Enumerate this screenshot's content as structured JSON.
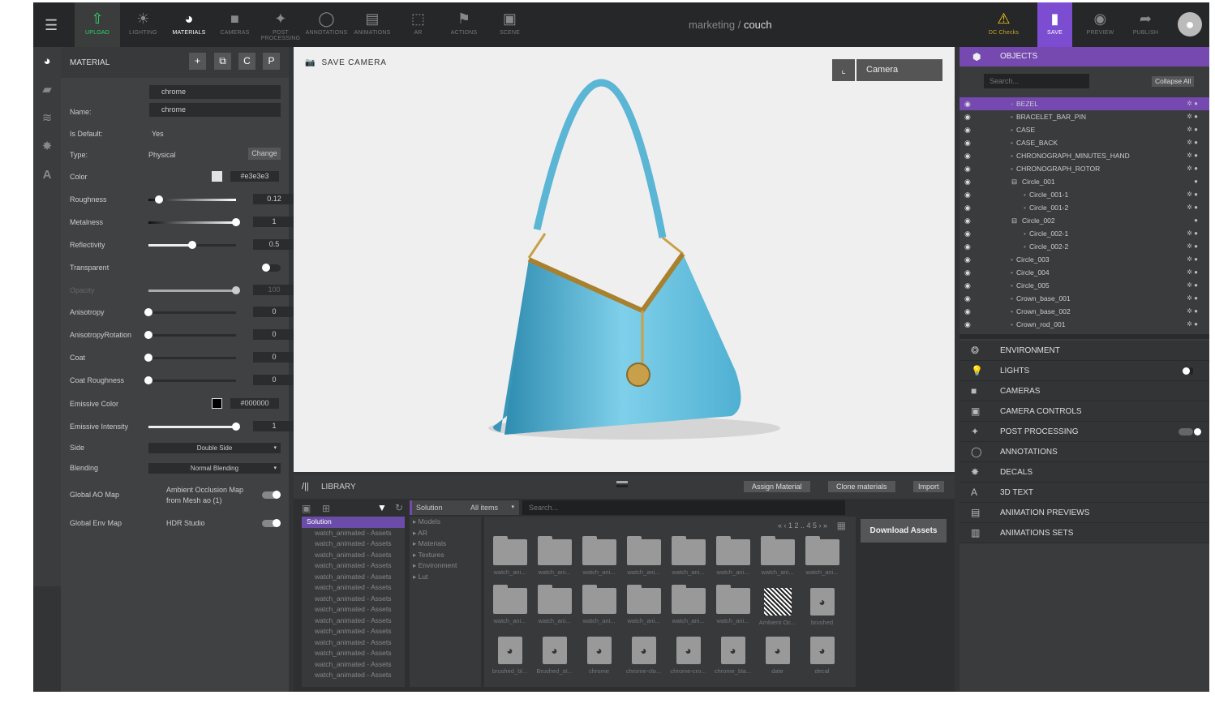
{
  "topbar": {
    "tools": [
      {
        "label": "UPLOAD",
        "icon": "upload-icon",
        "glyph": "⇧"
      },
      {
        "label": "LIGHTING",
        "icon": "sun-icon",
        "glyph": "☀"
      },
      {
        "label": "MATERIALS",
        "icon": "material-icon",
        "glyph": "◕"
      },
      {
        "label": "CAMERAS",
        "icon": "video-camera-icon",
        "glyph": "■"
      },
      {
        "label": "POST PROCESSING",
        "icon": "sparkles-icon",
        "glyph": "✦"
      },
      {
        "label": "ANNOTATIONS",
        "icon": "speech-bubble-icon",
        "glyph": "◯"
      },
      {
        "label": "ANIMATIONS",
        "icon": "film-icon",
        "glyph": "▤"
      },
      {
        "label": "AR",
        "icon": "ar-cube-icon",
        "glyph": "⬚"
      },
      {
        "label": "ACTIONS",
        "icon": "flag-icon",
        "glyph": "⚑"
      },
      {
        "label": "SCENE",
        "icon": "image-icon",
        "glyph": "▣"
      }
    ],
    "breadcrumb": {
      "project": "marketing",
      "separator": "/",
      "scene": "couch"
    },
    "right_tools": [
      {
        "label": "DC Checks",
        "icon": "warning-icon",
        "glyph": "⚠"
      },
      {
        "label": "SAVE",
        "icon": "bookmark-icon",
        "glyph": "▮"
      },
      {
        "label": "PREVIEW",
        "icon": "eye-icon",
        "glyph": "◉"
      },
      {
        "label": "PUBLISH",
        "icon": "share-arrow-icon",
        "glyph": "➦"
      }
    ]
  },
  "material": {
    "title": "MATERIAL",
    "search_value": "chrome",
    "name_label": "Name:",
    "name_value": "chrome",
    "is_default_label": "Is Default:",
    "is_default_value": "Yes",
    "type_label": "Type:",
    "type_value": "Physical",
    "change_label": "Change",
    "color": {
      "label": "Color",
      "value": "#e3e3e3"
    },
    "sliders": [
      {
        "label": "Roughness",
        "value": "0.12",
        "fraction": 0.12
      },
      {
        "label": "Metalness",
        "value": "1",
        "fraction": 1
      },
      {
        "label": "Reflectivity",
        "value": "0.5",
        "fraction": 0.5
      }
    ],
    "transparent_label": "Transparent",
    "transparent_on": false,
    "opacity": {
      "label": "Opacity",
      "value": "100",
      "fraction": 1
    },
    "sliders2": [
      {
        "label": "Anisotropy",
        "value": "0",
        "fraction": 0
      },
      {
        "label": "AnisotropyRotation",
        "value": "0",
        "fraction": 0
      },
      {
        "label": "Coat",
        "value": "0",
        "fraction": 0
      },
      {
        "label": "Coat Roughness",
        "value": "0",
        "fraction": 0
      }
    ],
    "emissive_color": {
      "label": "Emissive Color",
      "value": "#000000"
    },
    "emissive_intensity": {
      "label": "Emissive Intensity",
      "value": "1",
      "fraction": 1
    },
    "side": {
      "label": "Side",
      "value": "Double Side"
    },
    "blending": {
      "label": "Blending",
      "value": "Normal Blending"
    },
    "ao": {
      "label": "Global AO Map",
      "value": "Ambient Occlusion Map from Mesh ao (1)",
      "on": true
    },
    "env": {
      "label": "Global Env Map",
      "value": "HDR Studio",
      "on": true
    }
  },
  "viewport": {
    "save_camera": "SAVE CAMERA",
    "camera_select": "Camera"
  },
  "library": {
    "title": "LIBRARY",
    "buttons": [
      "Assign Material",
      "Clone materials",
      "Import"
    ],
    "filter_source": "Solution",
    "filter_items": "All items",
    "search_placeholder": "Search...",
    "download": "Download Assets",
    "tree_root": "Solution",
    "tree_items": [
      "watch_animated - Assets",
      "watch_animated - Assets",
      "watch_animated - Assets",
      "watch_animated - Assets",
      "watch_animated - Assets",
      "watch_animated - Assets",
      "watch_animated - Assets",
      "watch_animated - Assets",
      "watch_animated - Assets",
      "watch_animated - Assets",
      "watch_animated - Assets",
      "watch_animated - Assets",
      "watch_animated - Assets",
      "watch_animated - Assets"
    ],
    "categories": [
      "Models",
      "AR",
      "Materials",
      "Textures",
      "Environment",
      "Lut"
    ],
    "pagination": "« ‹ 1 2 .. 4 5 › »",
    "assets": [
      {
        "n": "watch_ani...",
        "k": "folder"
      },
      {
        "n": "watch_ani...",
        "k": "folder"
      },
      {
        "n": "watch_ani...",
        "k": "folder"
      },
      {
        "n": "watch_ani...",
        "k": "folder"
      },
      {
        "n": "watch_ani...",
        "k": "folder"
      },
      {
        "n": "watch_ani...",
        "k": "folder"
      },
      {
        "n": "watch_ani...",
        "k": "folder"
      },
      {
        "n": "watch_ani...",
        "k": "folder"
      },
      {
        "n": "watch_ani...",
        "k": "folder"
      },
      {
        "n": "watch_ani...",
        "k": "folder"
      },
      {
        "n": "watch_ani...",
        "k": "folder"
      },
      {
        "n": "watch_ani...",
        "k": "folder"
      },
      {
        "n": "watch_ani...",
        "k": "folder"
      },
      {
        "n": "watch_ani...",
        "k": "folder"
      },
      {
        "n": "Ambient Oc...",
        "k": "texture"
      },
      {
        "n": "brushed",
        "k": "material"
      },
      {
        "n": "brushed_bl...",
        "k": "material"
      },
      {
        "n": "Brushed_st...",
        "k": "material"
      },
      {
        "n": "chrome",
        "k": "material"
      },
      {
        "n": "chrome-clo...",
        "k": "material"
      },
      {
        "n": "chrome-cro...",
        "k": "material"
      },
      {
        "n": "chrome_bla...",
        "k": "material"
      },
      {
        "n": "date",
        "k": "material"
      },
      {
        "n": "decal",
        "k": "material"
      }
    ]
  },
  "objects": {
    "title": "OBJECTS",
    "search_placeholder": "Search...",
    "collapse_all": "Collapse All",
    "items": [
      {
        "n": "BEZEL",
        "d": 0,
        "sel": true
      },
      {
        "n": "BRACELET_BAR_PIN",
        "d": 0
      },
      {
        "n": "CASE",
        "d": 0
      },
      {
        "n": "CASE_BACK",
        "d": 0
      },
      {
        "n": "CHRONOGRAPH_MINUTES_HAND",
        "d": 0
      },
      {
        "n": "CHRONOGRAPH_ROTOR",
        "d": 0
      },
      {
        "n": "Circle_001",
        "d": 0,
        "group": true
      },
      {
        "n": "Circle_001-1",
        "d": 1
      },
      {
        "n": "Circle_001-2",
        "d": 1
      },
      {
        "n": "Circle_002",
        "d": 0,
        "group": true
      },
      {
        "n": "Circle_002-1",
        "d": 1
      },
      {
        "n": "Circle_002-2",
        "d": 1
      },
      {
        "n": "Circle_003",
        "d": 0
      },
      {
        "n": "Circle_004",
        "d": 0
      },
      {
        "n": "Circle_005",
        "d": 0
      },
      {
        "n": "Crown_base_001",
        "d": 0
      },
      {
        "n": "Crown_base_002",
        "d": 0
      },
      {
        "n": "Crown_rod_001",
        "d": 0
      }
    ]
  },
  "sections": [
    {
      "label": "ENVIRONMENT",
      "icon": "globe-icon",
      "glyph": "❂"
    },
    {
      "label": "LIGHTS",
      "icon": "lightbulb-icon",
      "glyph": "💡",
      "toggle": true
    },
    {
      "label": "CAMERAS",
      "icon": "video-camera-icon",
      "glyph": "■"
    },
    {
      "label": "CAMERA CONTROLS",
      "icon": "camera-controls-icon",
      "glyph": "▣"
    },
    {
      "label": "POST PROCESSING",
      "icon": "sparkles-icon",
      "glyph": "✦",
      "toggle": true
    },
    {
      "label": "ANNOTATIONS",
      "icon": "speech-bubble-icon",
      "glyph": "◯"
    },
    {
      "label": "DECALS",
      "icon": "badge-icon",
      "glyph": "✸"
    },
    {
      "label": "3D TEXT",
      "icon": "text-a-icon",
      "glyph": "A"
    },
    {
      "label": "ANIMATION PREVIEWS",
      "icon": "film-icon",
      "glyph": "▤"
    },
    {
      "label": "ANIMATIONS SETS",
      "icon": "film-add-icon",
      "glyph": "▥"
    }
  ],
  "colors": {
    "accent": "#7549b0",
    "save": "#7c4dd1",
    "upload": "#2fd46b",
    "warning": "#f2c811",
    "bag": "#62b9d8"
  }
}
